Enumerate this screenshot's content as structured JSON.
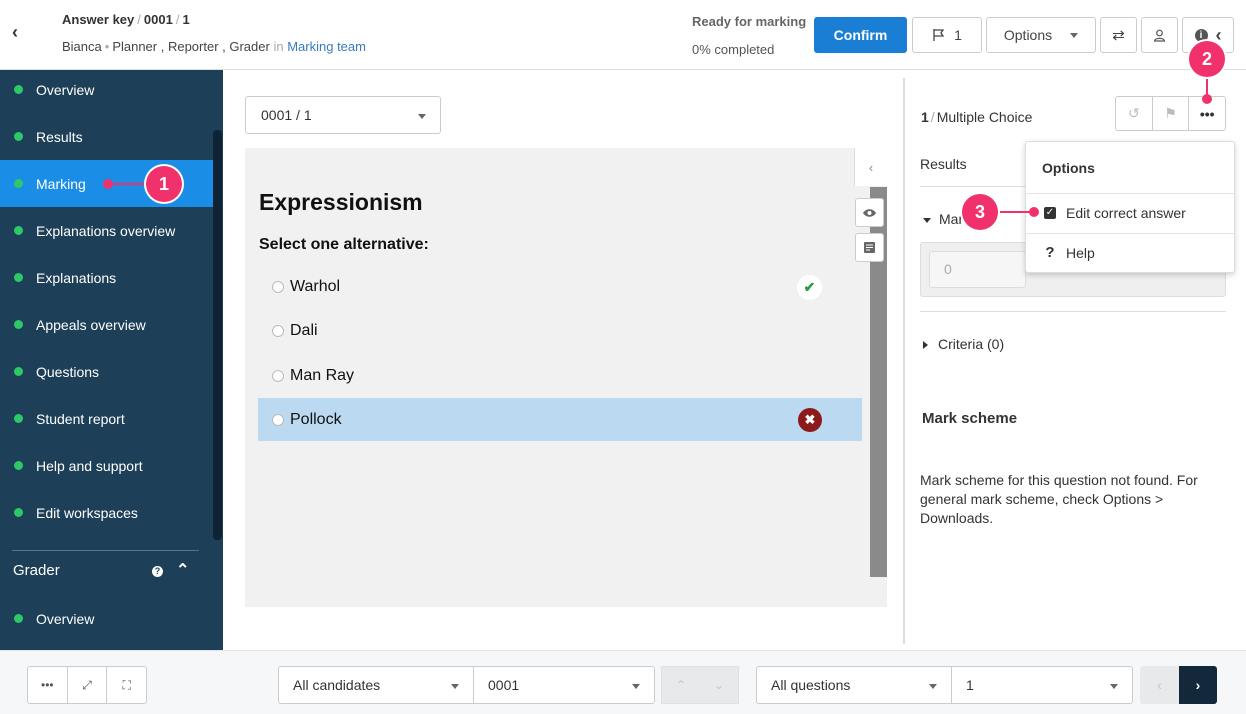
{
  "header": {
    "breadcrumb": [
      "Answer key",
      "0001",
      "1"
    ],
    "user": "Bianca",
    "roles": "Planner , Reporter , Grader",
    "in_label": "in",
    "team": "Marking team",
    "status_title": "Ready for marking",
    "status_sub": "0% completed",
    "confirm_label": "Confirm",
    "flag_count": "1",
    "options_label": "Options"
  },
  "sidebar": {
    "items": [
      {
        "label": "Overview",
        "active": false
      },
      {
        "label": "Results",
        "active": false
      },
      {
        "label": "Marking",
        "active": true
      },
      {
        "label": "Explanations overview",
        "active": false
      },
      {
        "label": "Explanations",
        "active": false
      },
      {
        "label": "Appeals overview",
        "active": false
      },
      {
        "label": "Questions",
        "active": false
      },
      {
        "label": "Student report",
        "active": false
      },
      {
        "label": "Help and support",
        "active": false
      },
      {
        "label": "Edit workspaces",
        "active": false
      }
    ],
    "grader_section": "Grader",
    "grader_items": [
      {
        "label": "Overview"
      }
    ]
  },
  "main": {
    "question_select": "0001 / 1",
    "question_title": "Expressionism",
    "instruction": "Select one alternative:",
    "alternatives": [
      {
        "label": "Warhol",
        "mark": "correct"
      },
      {
        "label": "Dali",
        "mark": ""
      },
      {
        "label": "Man Ray",
        "mark": ""
      },
      {
        "label": "Pollock",
        "mark": "wrong",
        "selected": true
      }
    ]
  },
  "right_panel": {
    "question_num": "1",
    "question_type": "Multiple Choice",
    "results_label": "Results",
    "marks_label": "Mar",
    "score_value": "0",
    "criteria_label": "Criteria (0)",
    "scheme_title": "Mark scheme",
    "scheme_text": "Mark scheme for this question not found. For general mark scheme, check Options > Downloads."
  },
  "options_menu": {
    "title": "Options",
    "items": [
      "Edit correct answer",
      "Help"
    ]
  },
  "callouts": [
    "1",
    "2",
    "3"
  ],
  "footer": {
    "candidates_select": "All candidates",
    "candidate_value": "0001",
    "questions_select": "All questions",
    "question_value": "1"
  },
  "colors": {
    "sidebar_bg": "#1d3f57",
    "active_item": "#1a8de6",
    "confirm_btn": "#1a7fd4",
    "callout": "#f0316b",
    "status_dot": "#2ec866"
  }
}
